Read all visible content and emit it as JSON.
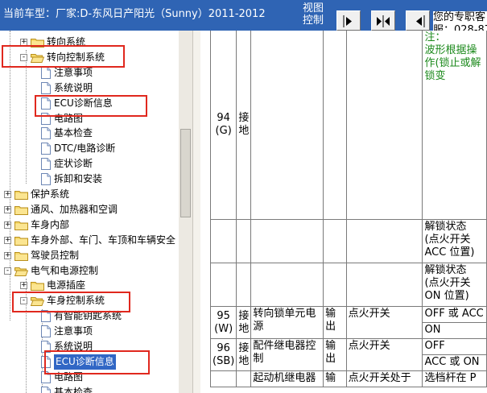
{
  "header": {
    "vehicle_title": "当前车型：厂家:D-东风日产阳光（Sunny）2011-2012",
    "view_control_label": "视图控制",
    "contact_text": "您的专职客\n服：028-87"
  },
  "tree": {
    "items": [
      {
        "label": "转向系统",
        "type": "folder",
        "expander": "+"
      },
      {
        "label": "转向控制系统",
        "type": "folder-open",
        "expander": "-"
      },
      {
        "label": "注意事项",
        "type": "doc"
      },
      {
        "label": "系统说明",
        "type": "doc"
      },
      {
        "label": "ECU诊断信息",
        "type": "doc"
      },
      {
        "label": "电路图",
        "type": "doc"
      },
      {
        "label": "基本检查",
        "type": "doc"
      },
      {
        "label": "DTC/电路诊断",
        "type": "doc"
      },
      {
        "label": "症状诊断",
        "type": "doc"
      },
      {
        "label": "拆卸和安装",
        "type": "doc"
      },
      {
        "label": "保护系统",
        "type": "folder",
        "expander": "+"
      },
      {
        "label": "通风、加热器和空调",
        "type": "folder",
        "expander": "+"
      },
      {
        "label": "车身内部",
        "type": "folder",
        "expander": "+"
      },
      {
        "label": "车身外部、车门、车顶和车辆安全",
        "type": "folder",
        "expander": "+"
      },
      {
        "label": "驾驶员控制",
        "type": "folder",
        "expander": "+"
      },
      {
        "label": "电气和电源控制",
        "type": "folder-open",
        "expander": "-"
      },
      {
        "label": "电源插座",
        "type": "folder",
        "expander": "+"
      },
      {
        "label": "车身控制系统",
        "type": "folder-open",
        "expander": "-"
      },
      {
        "label": "有智能钥匙系统",
        "type": "doc"
      },
      {
        "label": "注意事项",
        "type": "doc"
      },
      {
        "label": "系统说明",
        "type": "doc"
      },
      {
        "label": "ECU诊断信息",
        "type": "doc",
        "selected": true
      },
      {
        "label": "电路图",
        "type": "doc"
      },
      {
        "label": "基本检查",
        "type": "doc"
      }
    ]
  },
  "table": {
    "top_note_1": "注：",
    "top_note_2": "波形根据操作(锁止或解锁变",
    "rows": [
      {
        "terminal": "94\n(G)",
        "color_label": "接\n地",
        "desc": "",
        "io": "",
        "condition": "",
        "values": []
      },
      {
        "extra_1": "解锁状态\n(点火开关\nACC 位置)",
        "extra_2": "解锁状态\n(点火开关\nON 位置)"
      },
      {
        "terminal": "95\n(W)",
        "color_label": "接\n地",
        "desc": "转向锁单元电\n源",
        "io": "输\n出",
        "condition": "点火开关",
        "values": [
          "OFF 或 ACC",
          "ON"
        ]
      },
      {
        "terminal": "96\n(SB)",
        "color_label": "接\n地",
        "desc": "配件继电器控\n制",
        "io": "输\n出",
        "condition": "点火开关",
        "values": [
          "OFF",
          "ACC 或 ON"
        ]
      },
      {
        "terminal": "",
        "color_label": "",
        "desc": "起动机继电器",
        "io": "输",
        "condition": "点火开关处于",
        "values": [
          "选档杆在 P"
        ]
      }
    ]
  },
  "colors": {
    "header_bg": "#2f64b4",
    "highlight": "#e0281e",
    "selection": "#3167c5",
    "green_note": "#1d8a1d"
  }
}
